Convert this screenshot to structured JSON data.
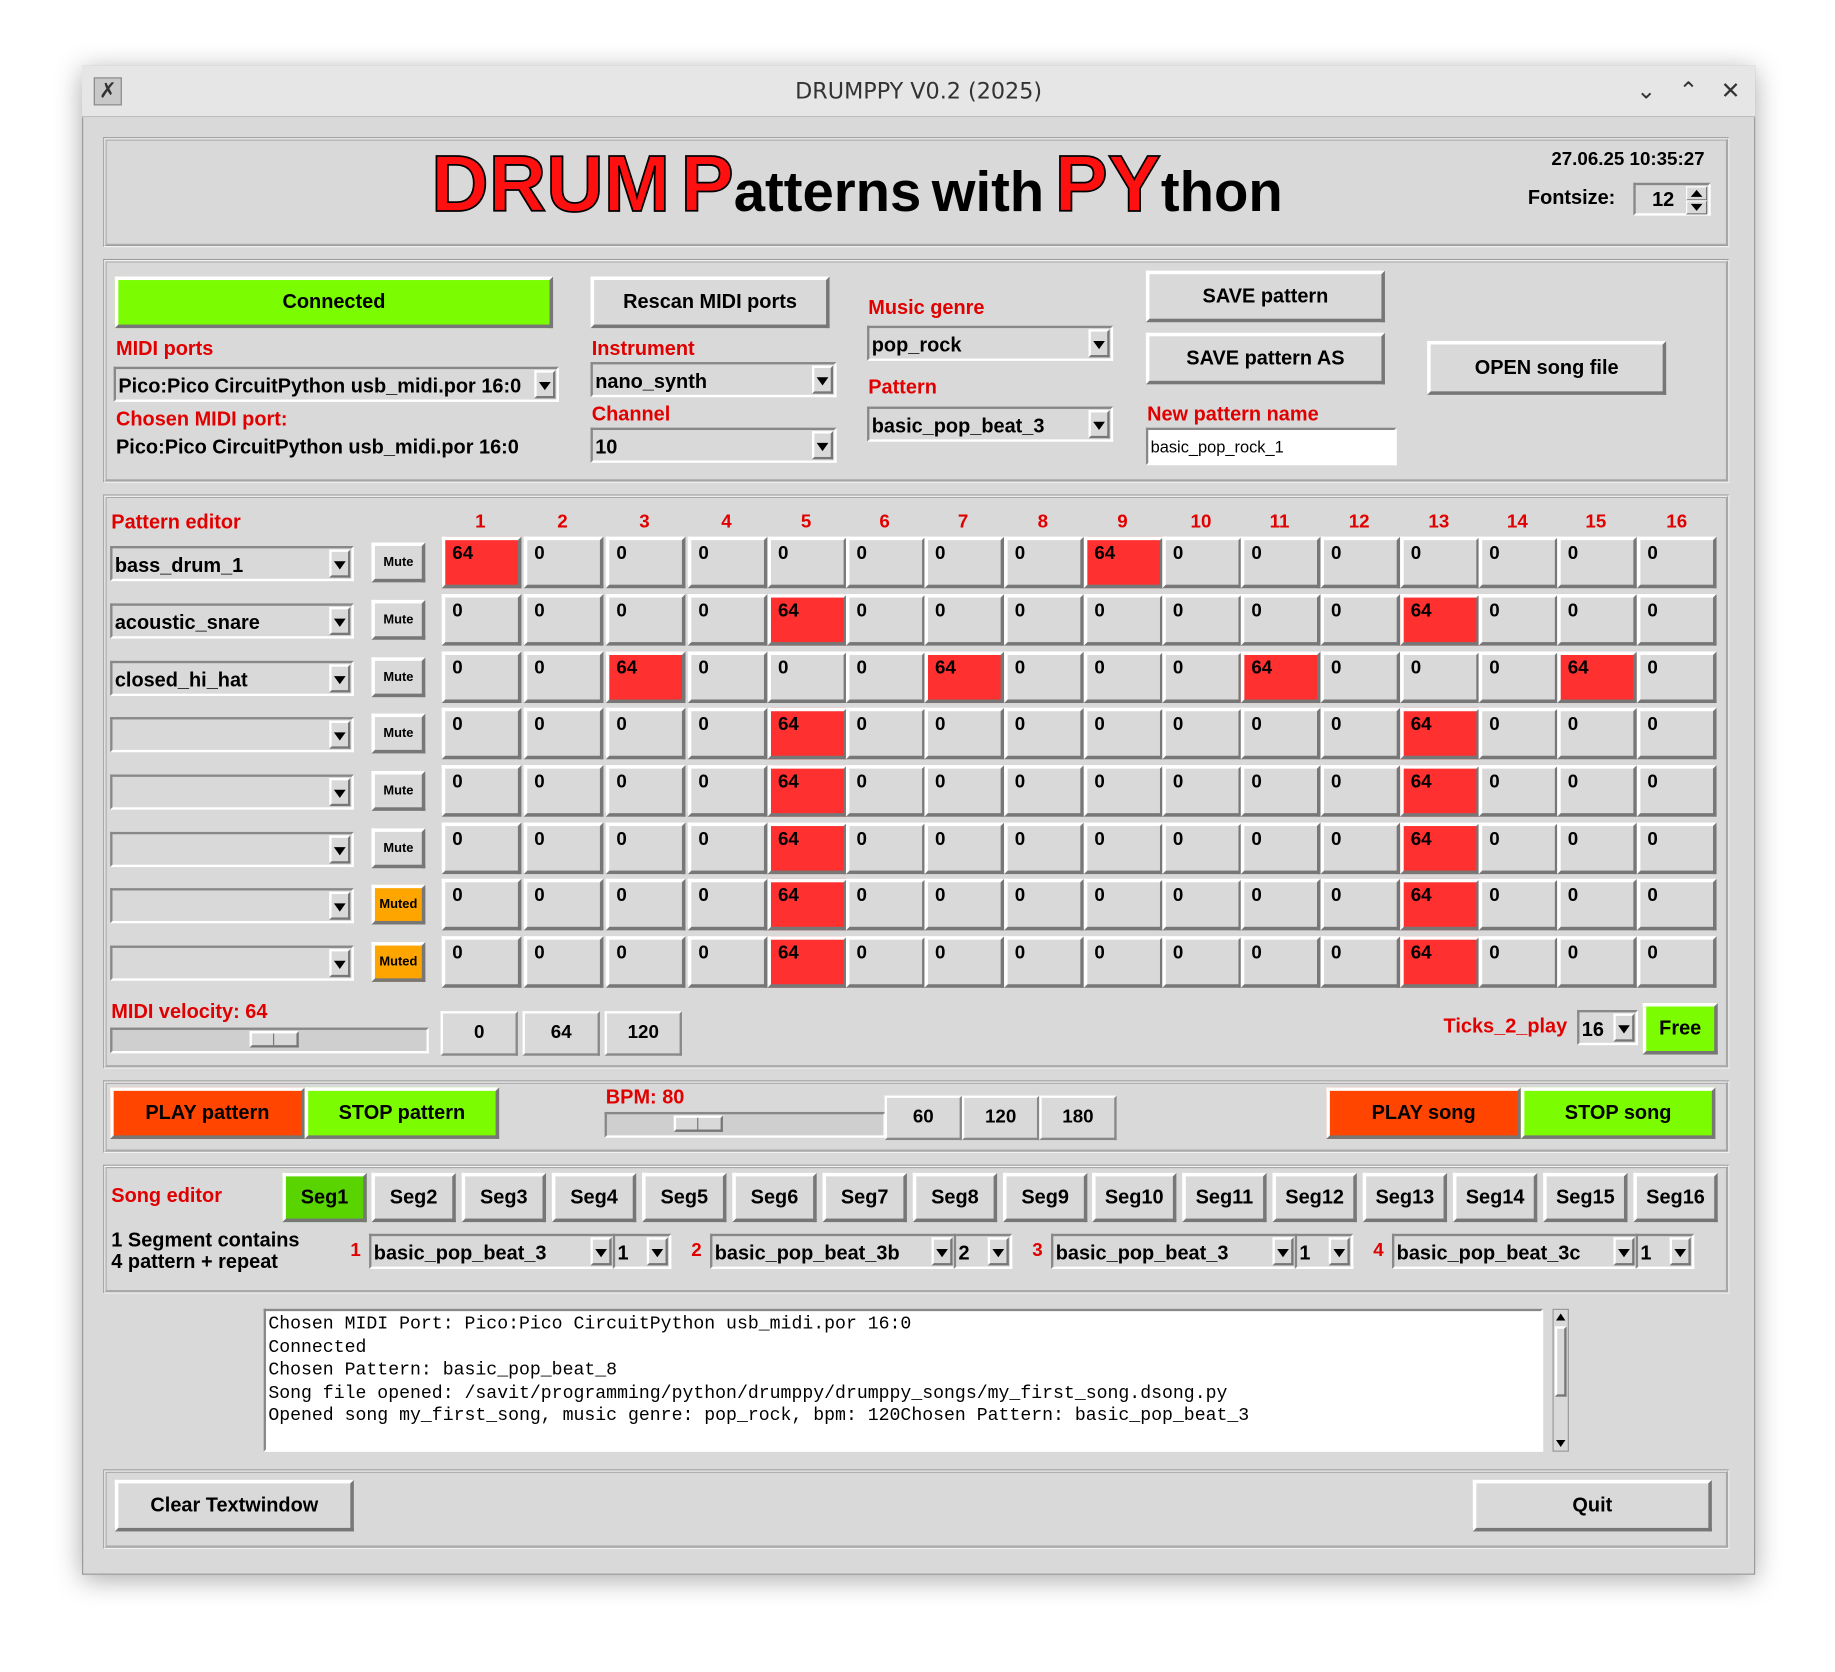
{
  "window": {
    "title": "DRUMPPY V0.2 (2025)"
  },
  "header": {
    "title_parts": [
      "DRUM",
      "P",
      "atterns",
      "with",
      "PY",
      "thon"
    ],
    "datetime": "27.06.25 10:35:27",
    "fontsize_label": "Fontsize:",
    "fontsize_value": "12"
  },
  "midi": {
    "status_label": "Connected",
    "ports_label": "MIDI ports",
    "port_value": "Pico:Pico CircuitPython usb_midi.por 16:0",
    "chosen_label": "Chosen MIDI port:",
    "chosen_value": "Pico:Pico CircuitPython usb_midi.por 16:0",
    "rescan_label": "Rescan MIDI ports",
    "instrument_label": "Instrument",
    "instrument_value": "nano_synth",
    "channel_label": "Channel",
    "channel_value": "10"
  },
  "genre": {
    "label": "Music genre",
    "value": "pop_rock",
    "pattern_label": "Pattern",
    "pattern_value": "basic_pop_beat_3"
  },
  "file": {
    "save_label": "SAVE pattern",
    "save_as_label": "SAVE pattern AS",
    "new_name_label": "New pattern name",
    "new_name_value": "basic_pop_rock_1",
    "open_song_label": "OPEN song file"
  },
  "pattern_editor": {
    "label": "Pattern editor",
    "columns": [
      "1",
      "2",
      "3",
      "4",
      "5",
      "6",
      "7",
      "8",
      "9",
      "10",
      "11",
      "12",
      "13",
      "14",
      "15",
      "16"
    ],
    "rows": [
      {
        "instrument": "bass_drum_1",
        "mute": "Mute",
        "muted": false,
        "values": [
          64,
          0,
          0,
          0,
          0,
          0,
          0,
          0,
          64,
          0,
          0,
          0,
          0,
          0,
          0,
          0
        ]
      },
      {
        "instrument": "acoustic_snare",
        "mute": "Mute",
        "muted": false,
        "values": [
          0,
          0,
          0,
          0,
          64,
          0,
          0,
          0,
          0,
          0,
          0,
          0,
          64,
          0,
          0,
          0
        ]
      },
      {
        "instrument": "closed_hi_hat",
        "mute": "Mute",
        "muted": false,
        "values": [
          0,
          0,
          64,
          0,
          0,
          0,
          64,
          0,
          0,
          0,
          64,
          0,
          0,
          0,
          64,
          0
        ]
      },
      {
        "instrument": "",
        "mute": "Mute",
        "muted": false,
        "values": [
          0,
          0,
          0,
          0,
          64,
          0,
          0,
          0,
          0,
          0,
          0,
          0,
          64,
          0,
          0,
          0
        ]
      },
      {
        "instrument": "",
        "mute": "Mute",
        "muted": false,
        "values": [
          0,
          0,
          0,
          0,
          64,
          0,
          0,
          0,
          0,
          0,
          0,
          0,
          64,
          0,
          0,
          0
        ]
      },
      {
        "instrument": "",
        "mute": "Mute",
        "muted": false,
        "values": [
          0,
          0,
          0,
          0,
          64,
          0,
          0,
          0,
          0,
          0,
          0,
          0,
          64,
          0,
          0,
          0
        ]
      },
      {
        "instrument": "",
        "mute": "Muted",
        "muted": true,
        "values": [
          0,
          0,
          0,
          0,
          64,
          0,
          0,
          0,
          0,
          0,
          0,
          0,
          64,
          0,
          0,
          0
        ]
      },
      {
        "instrument": "",
        "mute": "Muted",
        "muted": true,
        "values": [
          0,
          0,
          0,
          0,
          64,
          0,
          0,
          0,
          0,
          0,
          0,
          0,
          64,
          0,
          0,
          0
        ]
      }
    ],
    "velocity_label": "MIDI velocity: 64",
    "velocity_value": 64,
    "velocity_max": 127,
    "velocity_presets": [
      "0",
      "64",
      "120"
    ],
    "ticks_label": "Ticks_2_play",
    "ticks_value": "16",
    "free_label": "Free"
  },
  "transport": {
    "play_pattern": "PLAY pattern",
    "stop_pattern": "STOP pattern",
    "bpm_label": "BPM: 80",
    "bpm_value": 80,
    "bpm_min": 20,
    "bpm_max": 240,
    "bpm_presets": [
      "60",
      "120",
      "180"
    ],
    "play_song": "PLAY song",
    "stop_song": "STOP song"
  },
  "song_editor": {
    "label": "Song editor",
    "segments": [
      "Seg1",
      "Seg2",
      "Seg3",
      "Seg4",
      "Seg5",
      "Seg6",
      "Seg7",
      "Seg8",
      "Seg9",
      "Seg10",
      "Seg11",
      "Seg12",
      "Seg13",
      "Seg14",
      "Seg15",
      "Seg16"
    ],
    "active_segment": 0,
    "info_line1": "1 Segment contains",
    "info_line2": "4 pattern + repeat",
    "slots": [
      {
        "num": "1",
        "pattern": "basic_pop_beat_3",
        "repeat": "1"
      },
      {
        "num": "2",
        "pattern": "basic_pop_beat_3b",
        "repeat": "2"
      },
      {
        "num": "3",
        "pattern": "basic_pop_beat_3",
        "repeat": "1"
      },
      {
        "num": "4",
        "pattern": "basic_pop_beat_3c",
        "repeat": "1"
      }
    ]
  },
  "console": {
    "lines": [
      "Chosen MIDI Port: Pico:Pico CircuitPython usb_midi.por 16:0",
      "Connected",
      "Chosen Pattern: basic_pop_beat_8",
      "Song file opened: /savit/programming/python/drumppy/drumppy_songs/my_first_song.dsong.py",
      "Opened song my_first_song, music genre: pop_rock, bpm: 120Chosen Pattern: basic_pop_beat_3"
    ]
  },
  "footer": {
    "clear_label": "Clear Textwindow",
    "quit_label": "Quit"
  },
  "colors": {
    "connected": "#7cfc00",
    "play": "#ff4500",
    "stop": "#7cfc00",
    "active_cell": "#ff3030",
    "muted": "#ffa500",
    "label": "#e00000"
  }
}
